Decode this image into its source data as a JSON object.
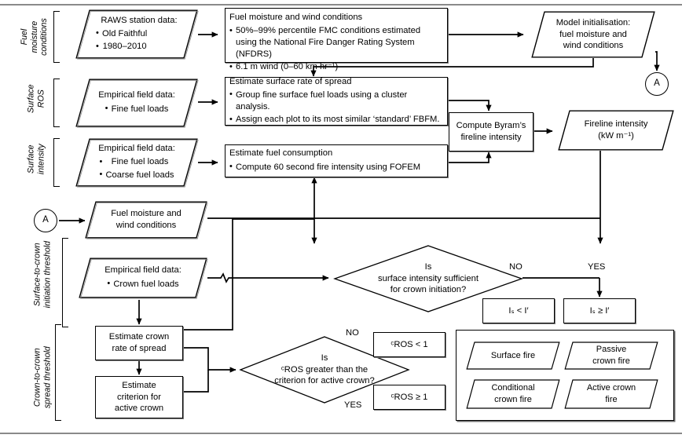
{
  "figure": {
    "type": "flowchart",
    "description": "Fire behaviour modelling flowchart"
  },
  "stages": [
    {
      "id": "fuel-moisture-conditions",
      "lines": [
        "Fuel",
        "moisture",
        "conditions"
      ]
    },
    {
      "id": "surface-ros",
      "lines": [
        "Surface",
        "ROS"
      ]
    },
    {
      "id": "surface-intensity",
      "lines": [
        "Surface",
        "intensity"
      ]
    },
    {
      "id": "surface-to-crown-initiation-threshold",
      "lines": [
        "Surface-to-crown",
        "initiation threshold"
      ]
    },
    {
      "id": "crown-to-crown-spread-threshold",
      "lines": [
        "Crown-to-crown",
        "spread threshold"
      ]
    }
  ],
  "nodes": {
    "raws_station_data": {
      "title": "RAWS station data:",
      "bullets": [
        "Old Faithful",
        "1980–2010"
      ]
    },
    "fuel_moisture_wind_conditions": {
      "title": "Fuel moisture and wind conditions",
      "bullets": [
        "50%–99% percentile FMC conditions estimated using the National Fire Danger Rating System (NFDRS)",
        "6.1 m wind (0–60 km hr⁻¹)"
      ]
    },
    "model_initialisation": {
      "lines": [
        "Model initialisation:",
        "fuel moisture and",
        "wind conditions"
      ]
    },
    "connector_a_out": {
      "label": "A"
    },
    "connector_a_in": {
      "label": "A"
    },
    "empirical_field_data_fine": {
      "title": "Empirical field data:",
      "bullets": [
        "Fine fuel loads"
      ]
    },
    "estimate_surface_rate_of_spread": {
      "title": "Estimate surface rate of spread",
      "bullets": [
        "Group fine surface fuel loads using a cluster analysis.",
        "Assign each plot to its most similar ‘standard’ FBFM."
      ]
    },
    "empirical_field_data_fine_coarse": {
      "title": "Empirical field data:",
      "bullets": [
        "Fine fuel loads",
        "Coarse fuel loads"
      ]
    },
    "estimate_fuel_consumption": {
      "title": "Estimate fuel consumption",
      "bullets": [
        "Compute 60 second fire intensity using FOFEM"
      ]
    },
    "compute_byrams_fireline_intensity": {
      "lines": [
        "Compute Byram’s",
        "fireline intensity"
      ]
    },
    "fireline_intensity": {
      "lines": [
        "Fireline intensity",
        "(kW m⁻¹)"
      ]
    },
    "fuel_moisture_wind_conditions_2": {
      "lines": [
        "Fuel moisture and",
        "wind conditions"
      ]
    },
    "empirical_field_data_crown": {
      "title": "Empirical field data:",
      "bullets": [
        "Crown fuel loads"
      ]
    },
    "decision_surface_intensity": {
      "lines": [
        "Is",
        "surface intensity sufficient",
        "for crown initiation?"
      ]
    },
    "outcome_is_lt_i": {
      "label": "Iₛ < I′"
    },
    "outcome_is_ge_i": {
      "label": "Iₛ ≥ I′"
    },
    "estimate_crown_rate_of_spread": {
      "lines": [
        "Estimate crown",
        "rate of spread"
      ]
    },
    "estimate_criterion_active_crown": {
      "lines": [
        "Estimate",
        "criterion for",
        "active crown"
      ]
    },
    "decision_cros": {
      "lines": [
        "Is",
        "ᶜROS greater than the",
        "criterion for active crown?"
      ]
    },
    "outcome_cros_lt_1": {
      "label": "ᶜROS < 1"
    },
    "outcome_cros_ge_1": {
      "label": "ᶜROS ≥ 1"
    }
  },
  "edge_labels": {
    "surface_intensity_no": "NO",
    "surface_intensity_yes": "YES",
    "cros_no": "NO",
    "cros_yes": "YES"
  },
  "legend": {
    "items": [
      {
        "id": "surface-fire",
        "lines": [
          "Surface fire"
        ]
      },
      {
        "id": "passive-crown-fire",
        "lines": [
          "Passive",
          "crown fire"
        ]
      },
      {
        "id": "conditional-crown-fire",
        "lines": [
          "Conditional",
          "crown fire"
        ]
      },
      {
        "id": "active-crown-fire",
        "lines": [
          "Active crown",
          "fire"
        ]
      }
    ]
  },
  "colors": {
    "stroke": "#000000",
    "shadow": "#7d7d7d",
    "background": "#ffffff",
    "rule": "#8a8a8a"
  }
}
